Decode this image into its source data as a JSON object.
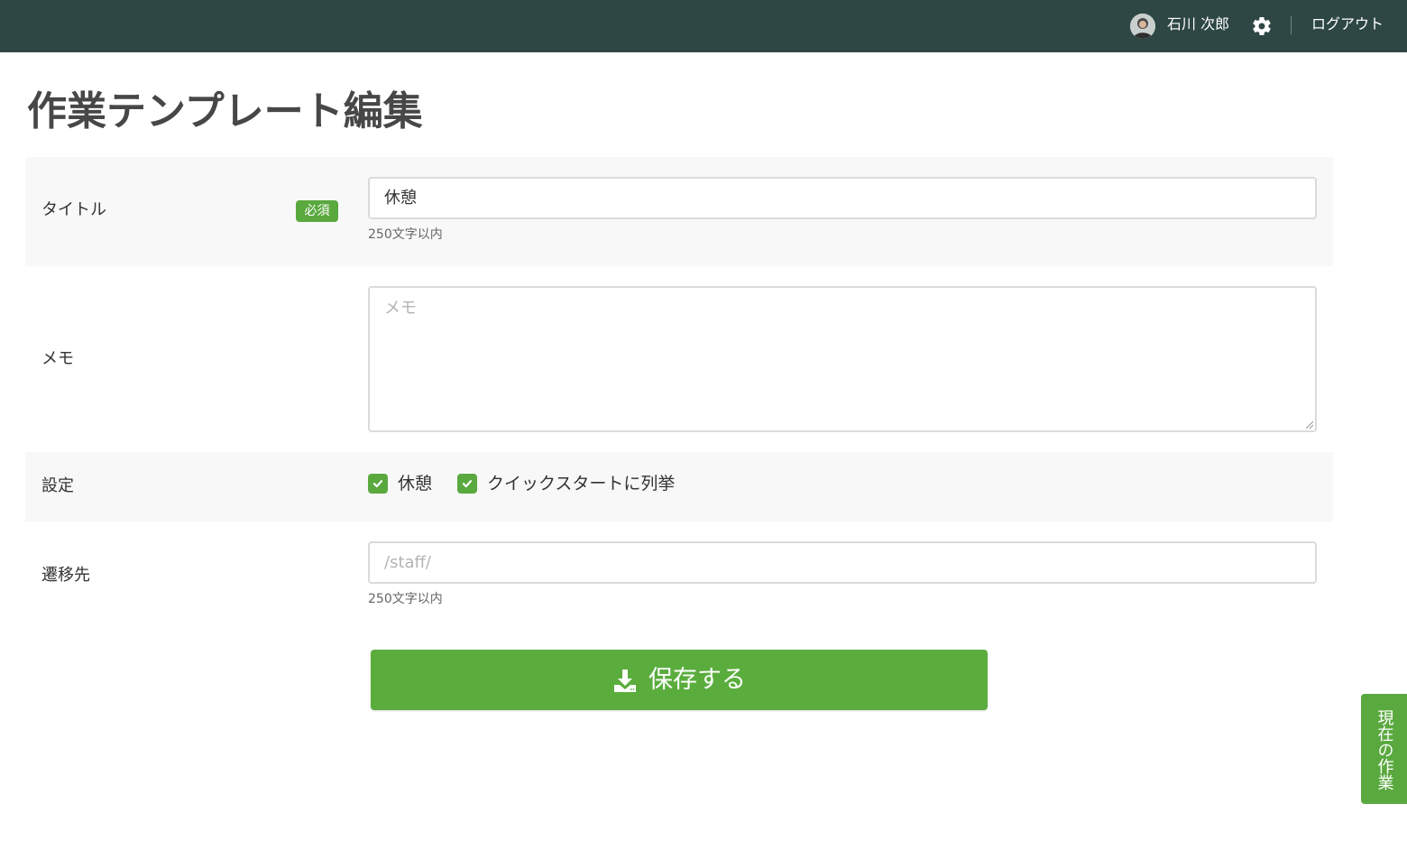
{
  "header": {
    "user_name": "石川 次郎",
    "logout_label": "ログアウト"
  },
  "page": {
    "title": "作業テンプレート編集"
  },
  "form": {
    "title_field": {
      "label": "タイトル",
      "required_badge": "必須",
      "value": "休憩",
      "help": "250文字以内"
    },
    "memo_field": {
      "label": "メモ",
      "placeholder": "メモ"
    },
    "settings_field": {
      "label": "設定",
      "options": [
        {
          "label": "休憩",
          "checked": true
        },
        {
          "label": "クイックスタートに列挙",
          "checked": true
        }
      ]
    },
    "destination_field": {
      "label": "遷移先",
      "placeholder": "/staff/",
      "help": "250文字以内"
    },
    "save_label": "保存する"
  },
  "side_tab": {
    "label": "現在の作業"
  },
  "colors": {
    "header_bg": "#2e4744",
    "accent_green": "#5aa93f"
  }
}
